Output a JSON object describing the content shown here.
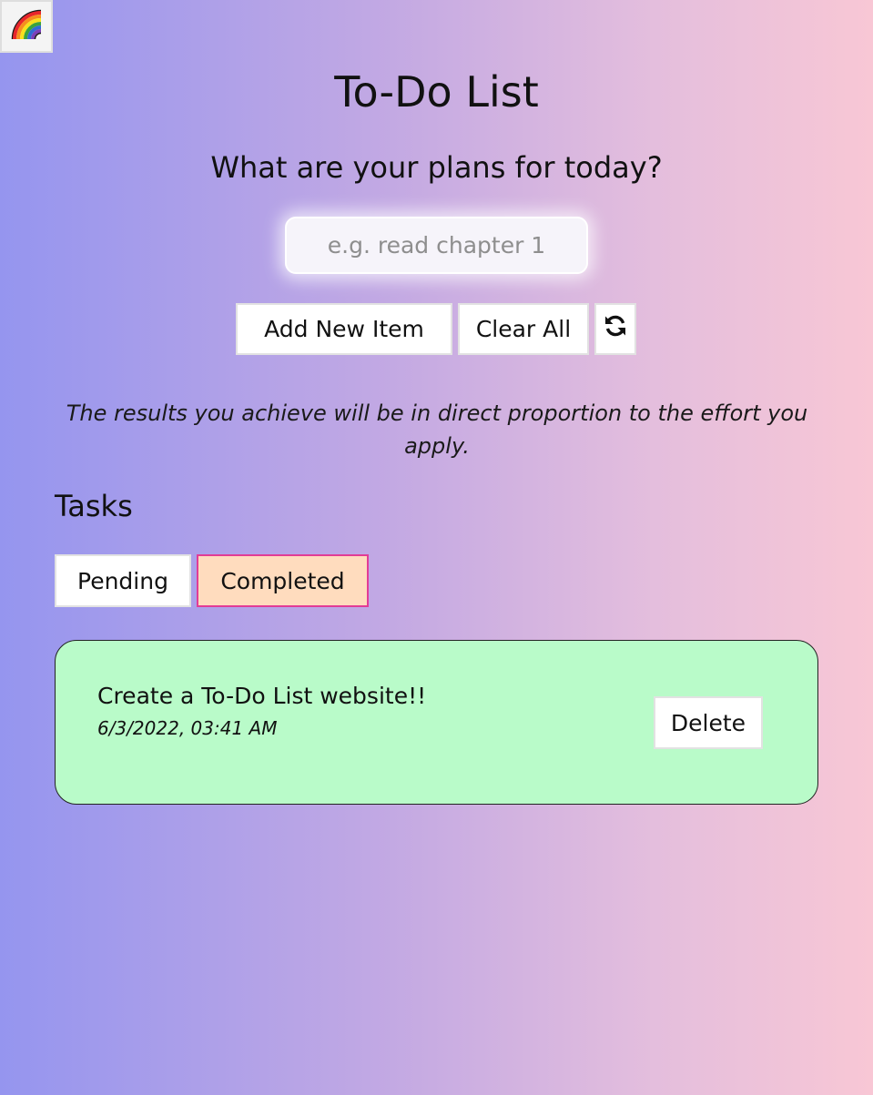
{
  "header": {
    "theme_icon": "rainbow-icon",
    "title": "To-Do List",
    "subtitle": "What are your plans for today?"
  },
  "input": {
    "placeholder": "e.g. read chapter 1",
    "value": ""
  },
  "actions": {
    "add_label": "Add New Item",
    "clear_label": "Clear All",
    "refresh_icon": "refresh-icon"
  },
  "quote": "The results you achieve will be in direct proportion to the effort you apply.",
  "tasks": {
    "heading": "Tasks",
    "tabs": [
      {
        "label": "Pending",
        "active": false
      },
      {
        "label": "Completed",
        "active": true
      }
    ],
    "items": [
      {
        "text": "Create a To-Do List website!!",
        "date": "6/3/2022, 03:41 AM",
        "delete_label": "Delete"
      }
    ]
  },
  "colors": {
    "gradient_start": "#9595ef",
    "gradient_end": "#f8c7d5",
    "task_card": "#b9fbc9",
    "active_tab_bg": "#ffdcbe",
    "active_tab_border": "#e23c96"
  }
}
